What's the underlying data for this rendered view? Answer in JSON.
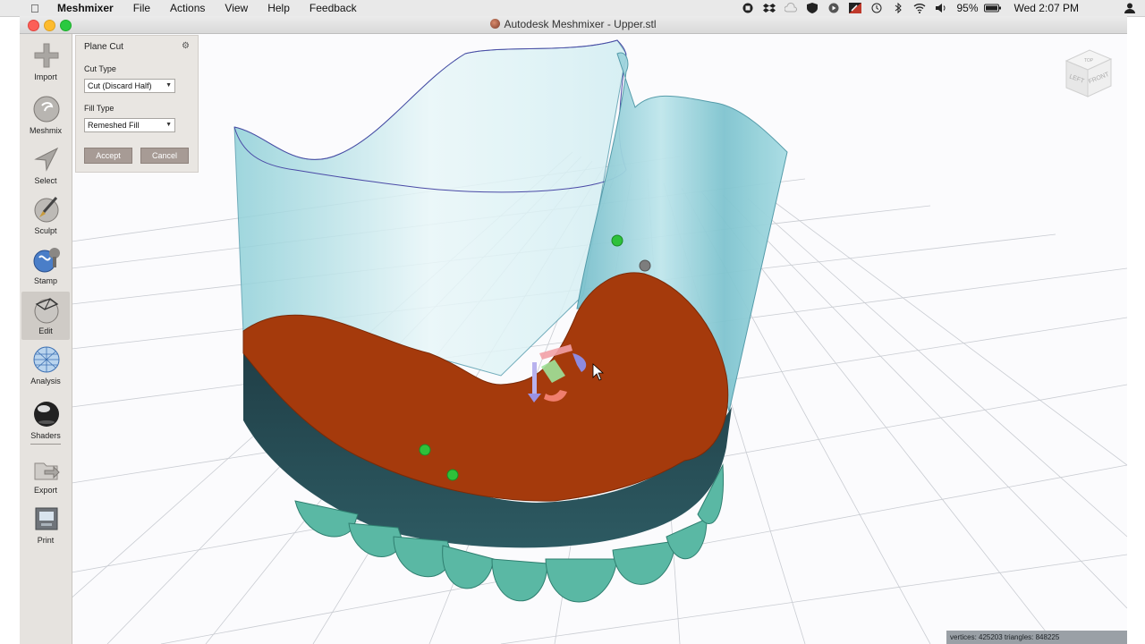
{
  "menubar": {
    "app_name": "Meshmixer",
    "items": [
      "File",
      "Actions",
      "View",
      "Help",
      "Feedback"
    ],
    "battery": "95%",
    "clock": "Wed 2:07 PM"
  },
  "window": {
    "title": "Autodesk Meshmixer - Upper.stl"
  },
  "toolbar": {
    "tools": [
      {
        "label": "Import",
        "icon": "plus-icon"
      },
      {
        "label": "Meshmix",
        "icon": "meshmix-sphere-icon"
      },
      {
        "label": "Select",
        "icon": "arrow-cursor-icon"
      },
      {
        "label": "Sculpt",
        "icon": "brush-sphere-icon"
      },
      {
        "label": "Stamp",
        "icon": "stamp-icon"
      },
      {
        "label": "Edit",
        "icon": "edit-sphere-icon",
        "active": true
      },
      {
        "label": "Analysis",
        "icon": "analysis-sphere-icon"
      },
      {
        "label": "Shaders",
        "icon": "shader-sphere-icon"
      },
      {
        "label": "Export",
        "icon": "export-icon"
      },
      {
        "label": "Print",
        "icon": "printer-icon"
      }
    ]
  },
  "plane_cut": {
    "title": "Plane Cut",
    "cut_type_label": "Cut Type",
    "cut_type_value": "Cut (Discard Half)",
    "fill_type_label": "Fill Type",
    "fill_type_value": "Remeshed Fill",
    "accept_label": "Accept",
    "cancel_label": "Cancel"
  },
  "viewcube": {
    "left_label": "LEFT",
    "front_label": "FRONT",
    "top_label": "TOP"
  },
  "status": {
    "stats": "vertices: 425203 triangles: 848225"
  },
  "colors": {
    "cut_surface": "#a53a0c",
    "teeth": "#5ab8a4",
    "shell": "#a9dde3",
    "toolbar_bg": "#e6e3df"
  }
}
